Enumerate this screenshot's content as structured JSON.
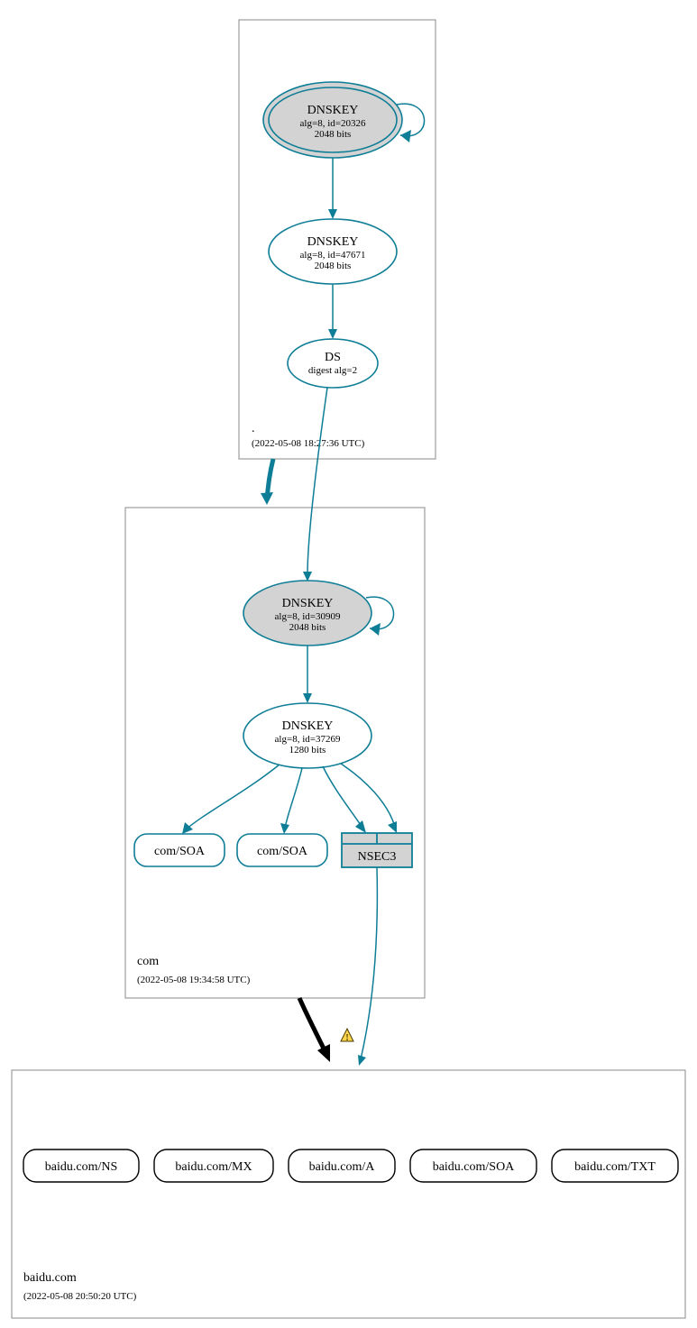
{
  "colors": {
    "teal": "#0e7d96",
    "fillGray": "#d3d3d3",
    "black": "#000000",
    "warnYellow": "#ffd54a",
    "warnBorder": "#4a3a00"
  },
  "zones": {
    "root": {
      "label": ".",
      "timestamp": "(2022-05-08 18:27:36 UTC)"
    },
    "com": {
      "label": "com",
      "timestamp": "(2022-05-08 19:34:58 UTC)"
    },
    "baidu": {
      "label": "baidu.com",
      "timestamp": "(2022-05-08 20:50:20 UTC)"
    }
  },
  "nodes": {
    "rootKsk": {
      "title": "DNSKEY",
      "line1": "alg=8, id=20326",
      "line2": "2048 bits"
    },
    "rootZsk": {
      "title": "DNSKEY",
      "line1": "alg=8, id=47671",
      "line2": "2048 bits"
    },
    "rootDs": {
      "title": "DS",
      "line1": "digest alg=2"
    },
    "comKsk": {
      "title": "DNSKEY",
      "line1": "alg=8, id=30909",
      "line2": "2048 bits"
    },
    "comZsk": {
      "title": "DNSKEY",
      "line1": "alg=8, id=37269",
      "line2": "1280 bits"
    },
    "comSoa1": {
      "title": "com/SOA"
    },
    "comSoa2": {
      "title": "com/SOA"
    },
    "nsec3": {
      "title": "NSEC3"
    },
    "baiduNs": {
      "title": "baidu.com/NS"
    },
    "baiduMx": {
      "title": "baidu.com/MX"
    },
    "baiduA": {
      "title": "baidu.com/A"
    },
    "baiduSoa": {
      "title": "baidu.com/SOA"
    },
    "baiduTxt": {
      "title": "baidu.com/TXT"
    }
  },
  "chart_data": {
    "type": "diagram",
    "description": "DNSSEC authentication chain / delegation graph",
    "zones": [
      {
        "name": ".",
        "timestamp": "2022-05-08 18:27:36 UTC"
      },
      {
        "name": "com",
        "timestamp": "2022-05-08 19:34:58 UTC"
      },
      {
        "name": "baidu.com",
        "timestamp": "2022-05-08 20:50:20 UTC"
      }
    ],
    "nodes": [
      {
        "id": "rootKsk",
        "zone": ".",
        "type": "DNSKEY",
        "alg": 8,
        "key_id": 20326,
        "bits": 2048,
        "ksk": true,
        "self_signed": true
      },
      {
        "id": "rootZsk",
        "zone": ".",
        "type": "DNSKEY",
        "alg": 8,
        "key_id": 47671,
        "bits": 2048,
        "ksk": false
      },
      {
        "id": "rootDs",
        "zone": ".",
        "type": "DS",
        "digest_alg": 2
      },
      {
        "id": "comKsk",
        "zone": "com",
        "type": "DNSKEY",
        "alg": 8,
        "key_id": 30909,
        "bits": 2048,
        "ksk": true,
        "self_signed": true
      },
      {
        "id": "comZsk",
        "zone": "com",
        "type": "DNSKEY",
        "alg": 8,
        "key_id": 37269,
        "bits": 1280,
        "ksk": false
      },
      {
        "id": "comSoa1",
        "zone": "com",
        "type": "SOA",
        "name": "com"
      },
      {
        "id": "comSoa2",
        "zone": "com",
        "type": "SOA",
        "name": "com"
      },
      {
        "id": "nsec3",
        "zone": "com",
        "type": "NSEC3"
      },
      {
        "id": "baiduNs",
        "zone": "baidu.com",
        "type": "NS",
        "name": "baidu.com"
      },
      {
        "id": "baiduMx",
        "zone": "baidu.com",
        "type": "MX",
        "name": "baidu.com"
      },
      {
        "id": "baiduA",
        "zone": "baidu.com",
        "type": "A",
        "name": "baidu.com"
      },
      {
        "id": "baiduSoa",
        "zone": "baidu.com",
        "type": "SOA",
        "name": "baidu.com"
      },
      {
        "id": "baiduTxt",
        "zone": "baidu.com",
        "type": "TXT",
        "name": "baidu.com"
      }
    ],
    "edges": [
      {
        "from": "rootKsk",
        "to": "rootKsk",
        "kind": "self-sign",
        "color": "teal"
      },
      {
        "from": "rootKsk",
        "to": "rootZsk",
        "kind": "signs",
        "color": "teal"
      },
      {
        "from": "rootZsk",
        "to": "rootDs",
        "kind": "signs",
        "color": "teal"
      },
      {
        "from": "rootDs",
        "to": "comKsk",
        "kind": "delegation",
        "color": "teal"
      },
      {
        "from": ".",
        "to": "com",
        "kind": "zone-delegation",
        "color": "teal",
        "thick": true
      },
      {
        "from": "comKsk",
        "to": "comKsk",
        "kind": "self-sign",
        "color": "teal"
      },
      {
        "from": "comKsk",
        "to": "comZsk",
        "kind": "signs",
        "color": "teal"
      },
      {
        "from": "comZsk",
        "to": "comSoa1",
        "kind": "signs",
        "color": "teal"
      },
      {
        "from": "comZsk",
        "to": "comSoa2",
        "kind": "signs",
        "color": "teal"
      },
      {
        "from": "comZsk",
        "to": "nsec3",
        "kind": "signs",
        "color": "teal"
      },
      {
        "from": "nsec3",
        "to": "baidu.com",
        "kind": "nsec-proof",
        "color": "teal",
        "warning": true
      },
      {
        "from": "com",
        "to": "baidu.com",
        "kind": "zone-delegation",
        "color": "black",
        "thick": true
      }
    ]
  }
}
